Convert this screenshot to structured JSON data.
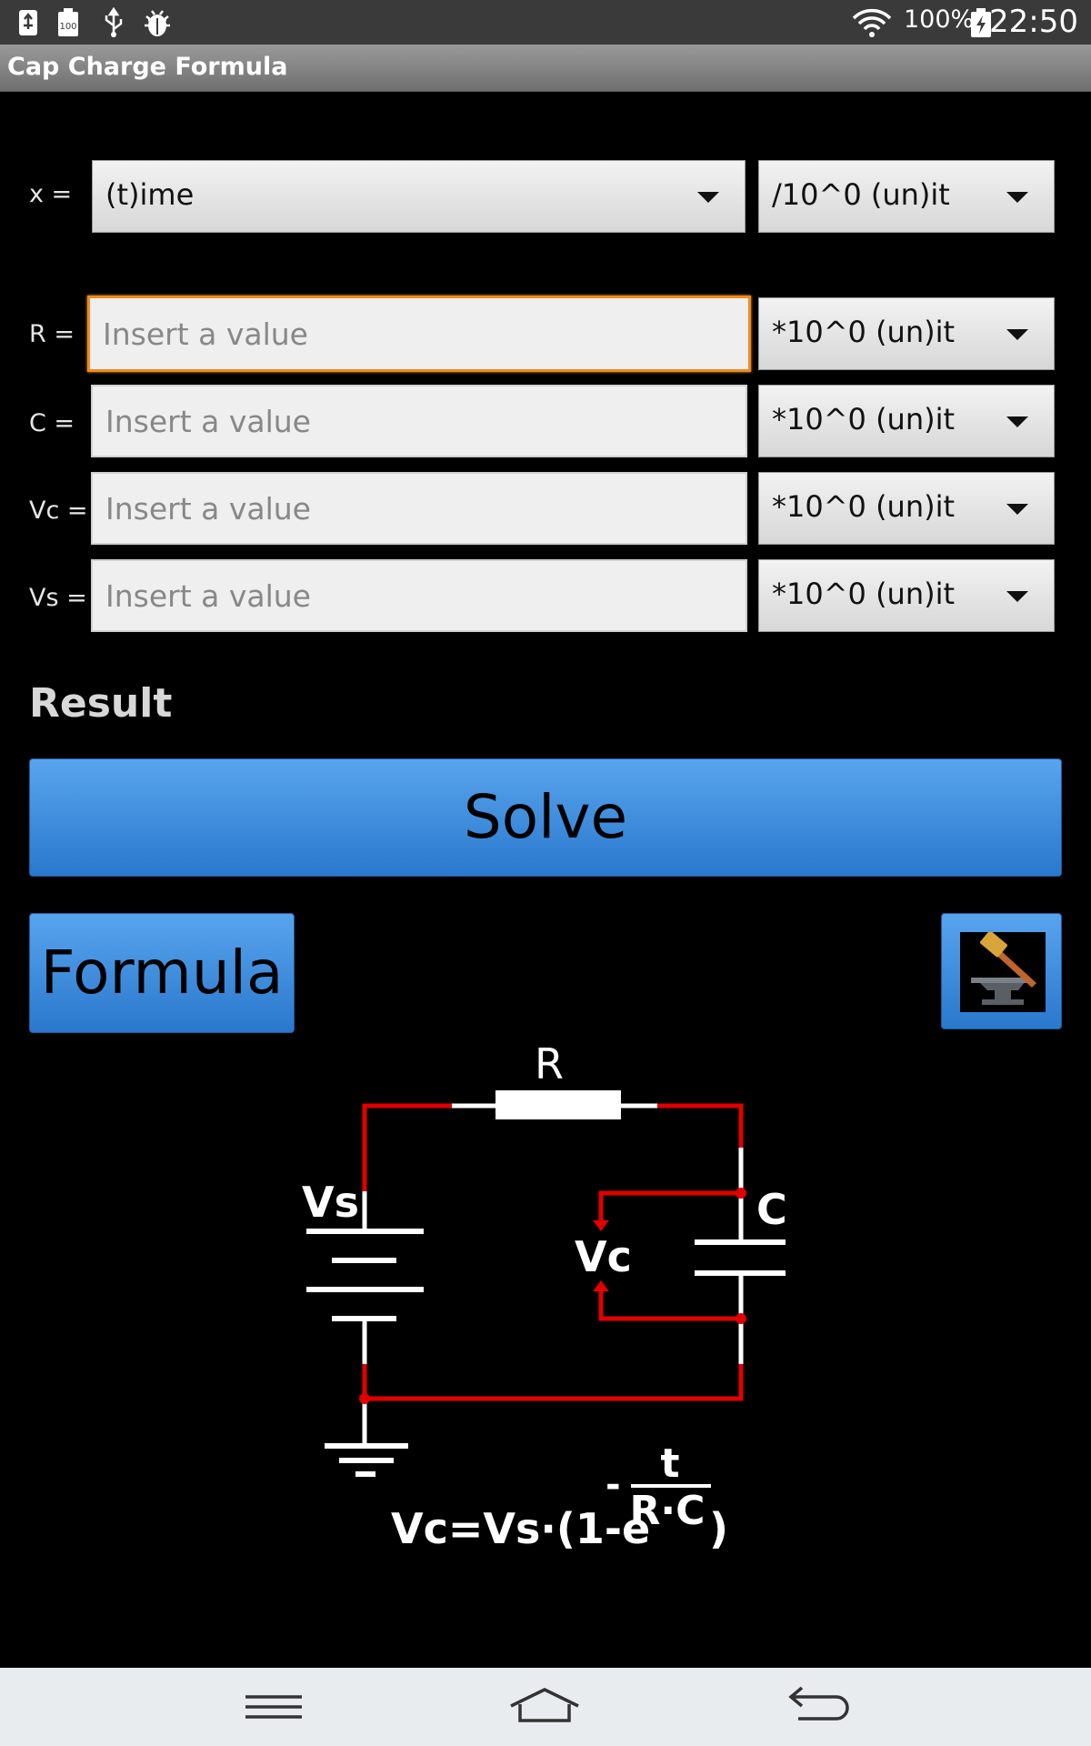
{
  "status_bar": {
    "battery_percent": "100%",
    "time": "22:50",
    "icons": [
      "usb-debug-icon",
      "battery-100-icon",
      "usb-icon",
      "android-debug-icon",
      "wifi-icon",
      "battery-charging-icon"
    ]
  },
  "app": {
    "title": "Cap Charge Formula"
  },
  "form": {
    "x_label": "x =",
    "x_variable": "(t)ime",
    "x_unit": "/10^0 (un)it",
    "rows": [
      {
        "label": "R =",
        "placeholder": "Insert a value",
        "value": "",
        "unit": "*10^0 (un)it"
      },
      {
        "label": "C =",
        "placeholder": "Insert a value",
        "value": "",
        "unit": "*10^0 (un)it"
      },
      {
        "label": "Vc =",
        "placeholder": "Insert a value",
        "value": "",
        "unit": "*10^0 (un)it"
      },
      {
        "label": "Vs =",
        "placeholder": "Insert a value",
        "value": "",
        "unit": "*10^0 (un)it"
      }
    ]
  },
  "result_label": "Result",
  "buttons": {
    "solve": "Solve",
    "formula": "Formula"
  },
  "circuit": {
    "resistor_label": "R",
    "source_label": "Vs",
    "capacitor_label": "C",
    "cap_voltage_label": "Vc",
    "equation_main": "Vc=Vs·(1-e",
    "equation_exp_num": "t",
    "equation_exp_den": "R·C",
    "equation_minus": "-",
    "equation_close": ")"
  },
  "colors": {
    "accent": "#3a8ae0",
    "focus": "#f08a1c",
    "wire": "#e00000"
  }
}
